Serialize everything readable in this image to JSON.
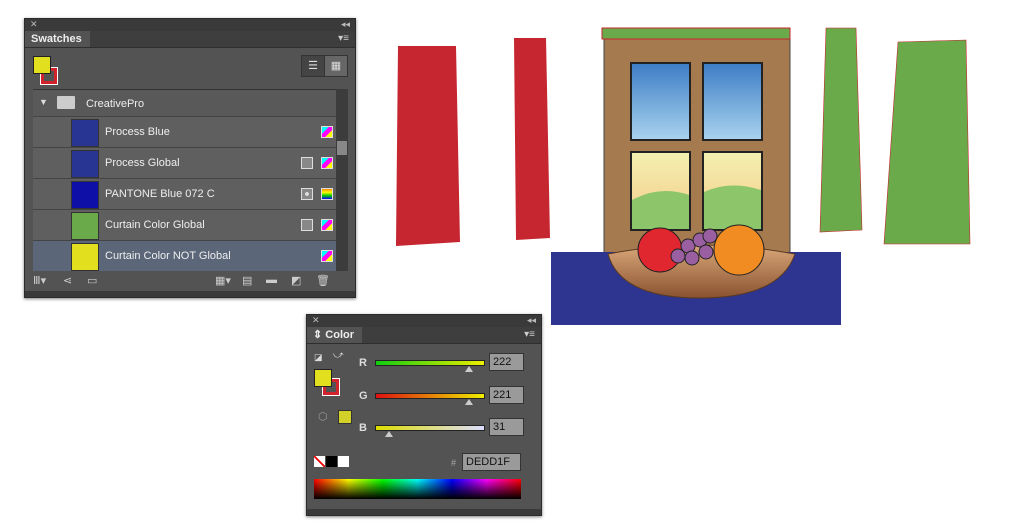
{
  "swatches": {
    "title": "Swatches",
    "group": "CreativePro",
    "items": [
      {
        "name": "Process Blue",
        "color": "#283593",
        "global": false,
        "spot": false,
        "mode": "cmyk"
      },
      {
        "name": "Process Global",
        "color": "#283593",
        "global": true,
        "spot": false,
        "mode": "cmyk"
      },
      {
        "name": "PANTONE Blue 072 C",
        "color": "#0d0fa6",
        "global": true,
        "spot": true,
        "mode": "lab"
      },
      {
        "name": "Curtain Color Global",
        "color": "#6aaa4a",
        "global": true,
        "spot": false,
        "mode": "cmyk"
      },
      {
        "name": "Curtain Color NOT Global",
        "color": "#e2df1f",
        "global": false,
        "spot": false,
        "mode": "cmyk",
        "selected": true
      }
    ]
  },
  "color": {
    "title": "Color",
    "fill": "#DEDD1F",
    "stroke": "#d0232b",
    "r": {
      "label": "R",
      "value": "222"
    },
    "g": {
      "label": "G",
      "value": "221"
    },
    "b": {
      "label": "B",
      "value": "31"
    },
    "hex_label": "#",
    "hex": "DEDD1F"
  },
  "colors": {
    "red_curtain": "#c5262f",
    "green_curtain": "#6aaa4a",
    "table": "#2d3590",
    "frame": "#a57a4f"
  }
}
